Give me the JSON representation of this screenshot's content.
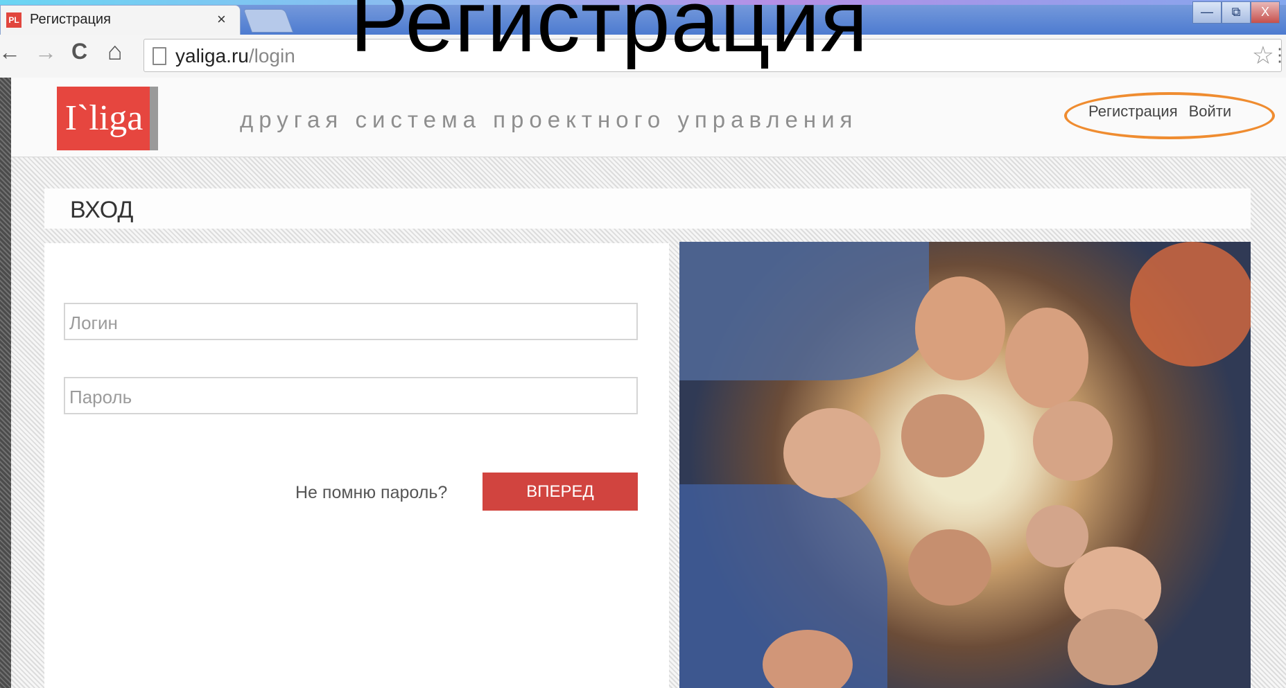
{
  "slide": {
    "title": "Регистрация"
  },
  "browser": {
    "tab_title": "Регистрация",
    "tab_favicon_text": "PL",
    "tab_close": "×",
    "url_host": "yaliga.ru",
    "url_path": "/login",
    "icons": {
      "back": "←",
      "forward": "→",
      "reload": "C",
      "home": "⌂",
      "bookmark_star": "☆",
      "menu": "⋮",
      "minimize": "—",
      "restore": "⧉",
      "close": "X"
    }
  },
  "site": {
    "logo": "I`liga",
    "tagline": "другая система проектного управления",
    "nav": {
      "register": "Регистрация",
      "login": "Войти"
    },
    "accent_color": "#e6463f",
    "highlight_color": "#ef8c30"
  },
  "login": {
    "title": "ВХОД",
    "login_placeholder": "Логин",
    "password_placeholder": "Пароль",
    "forgot": "Не помню пароль?",
    "submit": "ВПЕРЕД"
  }
}
